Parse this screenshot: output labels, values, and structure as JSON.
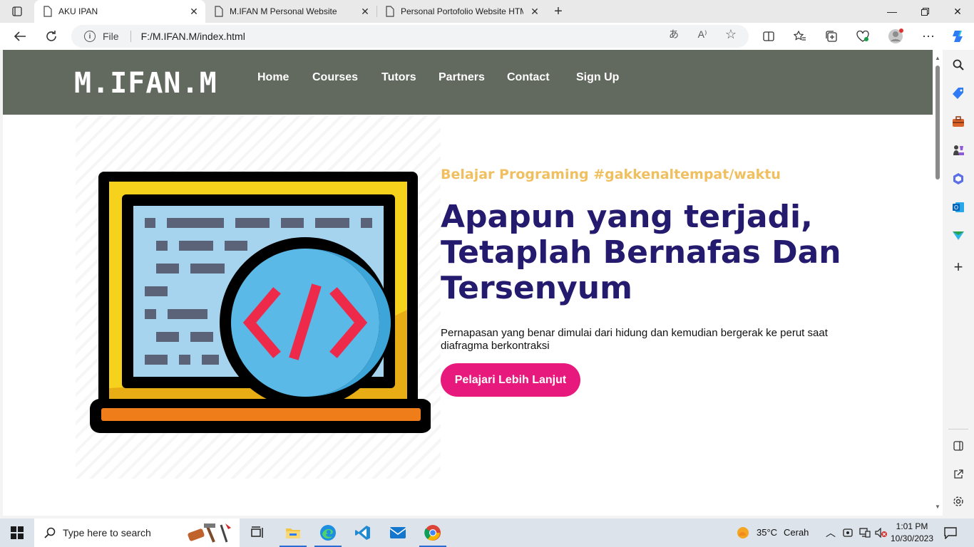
{
  "browser": {
    "tabs": [
      {
        "title": "AKU IPAN",
        "active": true
      },
      {
        "title": "M.IFAN M Personal Website",
        "active": false
      },
      {
        "title": "Personal Portofolio Website HTML",
        "active": false
      }
    ],
    "address": {
      "protocol_label": "File",
      "url": "F:/M.IFAN.M/index.html"
    }
  },
  "site": {
    "logo": "M.IFAN.M",
    "nav": [
      "Home",
      "Courses",
      "Tutors",
      "Partners",
      "Contact",
      "Sign Up"
    ],
    "hero": {
      "tagline": "Belajar Programing #gakkenaltempat/waktu",
      "title_lines": [
        "Apapun yang terjadi,",
        "Tetaplah Bernafas Dan",
        "Tersenyum"
      ],
      "description": "Pernapasan yang benar dimulai dari hidung dan kemudian bergerak ke perut saat diafragma berkontraksi",
      "button": "Pelajari Lebih Lanjut"
    }
  },
  "taskbar": {
    "search_placeholder": "Type here to search",
    "weather": {
      "temp": "35°C",
      "condition": "Cerah"
    },
    "time": "1:01 PM",
    "date": "10/30/2023"
  },
  "colors": {
    "header_bg": "#626a5f",
    "tagline": "#f0c060",
    "title": "#241a6e",
    "button_bg": "#e8197c"
  }
}
